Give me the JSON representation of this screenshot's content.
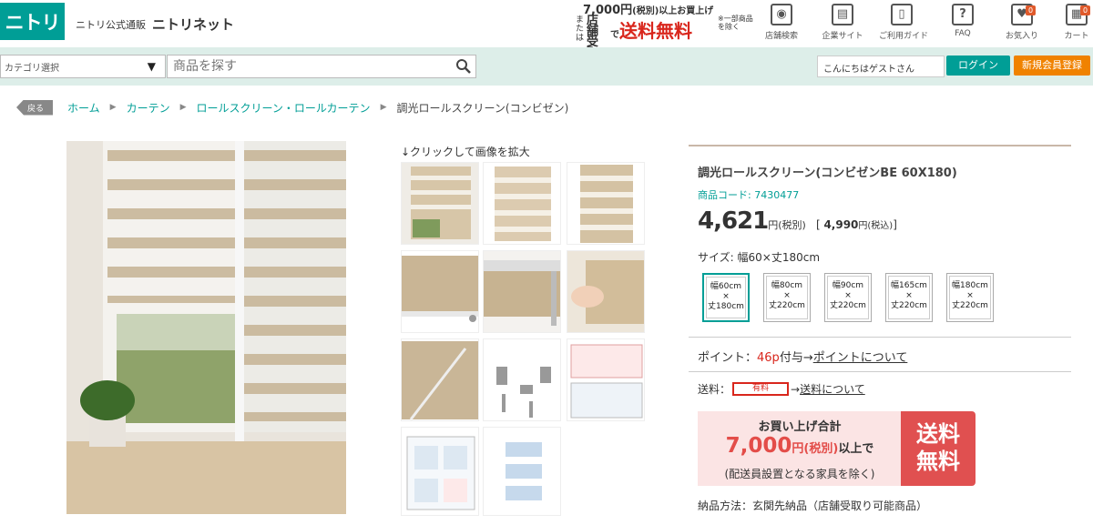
{
  "header": {
    "logo": "ニトリ",
    "sub": "ニトリ公式通販",
    "name": "ニトリネット",
    "promo": {
      "line1_amount": "7,000円",
      "line1_tax": "(税別)",
      "line1_rest": "以上お買上げ",
      "store_small": "または",
      "store_big": "店舗受取",
      "de": "で",
      "free": "送料無料",
      "note": "※一部商品を除く"
    },
    "icons": [
      {
        "label": "店舗検索",
        "glyph": "◉"
      },
      {
        "label": "企業サイト",
        "glyph": "▤"
      },
      {
        "label": "ご利用ガイド",
        "glyph": "▯"
      },
      {
        "label": "FAQ",
        "glyph": "?"
      },
      {
        "label": "お気入り",
        "glyph": "♥",
        "badge": "0"
      },
      {
        "label": "カート",
        "glyph": "▦",
        "badge": "0"
      }
    ]
  },
  "search": {
    "category": "カテゴリ選択",
    "placeholder": "商品を探す",
    "greeting": "こんにちはゲストさん",
    "login": "ログイン",
    "register": "新規会員登録"
  },
  "breadcrumb": {
    "back": "戻る",
    "items": [
      "ホーム",
      "カーテン",
      "ロールスクリーン・ロールカーテン"
    ],
    "current": "調光ロールスクリーン(コンビゼン)"
  },
  "gallery": {
    "zoom_hint": "↓クリックして画像を拡大"
  },
  "product": {
    "title": "調光ロールスクリーン(コンビゼンBE 60X180)",
    "code": "商品コード: 7430477",
    "price": "4,621",
    "price_unit": "円(税別)",
    "tax_open": "[ ",
    "tax_price": "4,990",
    "tax_unit": "円(税込)",
    "tax_close": "]",
    "size_label": "サイズ: 幅60×丈180cm",
    "sizes": [
      {
        "w": "幅60cm",
        "x": "×",
        "h": "丈180cm"
      },
      {
        "w": "幅80cm",
        "x": "×",
        "h": "丈220cm"
      },
      {
        "w": "幅90cm",
        "x": "×",
        "h": "丈220cm"
      },
      {
        "w": "幅165cm",
        "x": "×",
        "h": "丈220cm"
      },
      {
        "w": "幅180cm",
        "x": "×",
        "h": "丈220cm"
      }
    ],
    "points_label": "ポイント：",
    "points_value": "46p",
    "points_suffix": "付与→",
    "points_link": "ポイントについて",
    "shipping_label": "送料：",
    "shipping_badge": "有料",
    "shipping_arrow": "→",
    "shipping_link": "送料について",
    "free_title": "お買い上げ合計",
    "free_amount": "7,000",
    "free_unit": "円(税別)",
    "free_above": "以上で",
    "free_note": "(配送員設置となる家具を除く)",
    "free_tag1": "送料",
    "free_tag2": "無料",
    "delivery": "納品方法：玄関先納品（店舗受取り可能商品）"
  },
  "colors": {
    "brand": "#009e96",
    "accent": "#f08200",
    "sale_red": "#d9261c"
  }
}
